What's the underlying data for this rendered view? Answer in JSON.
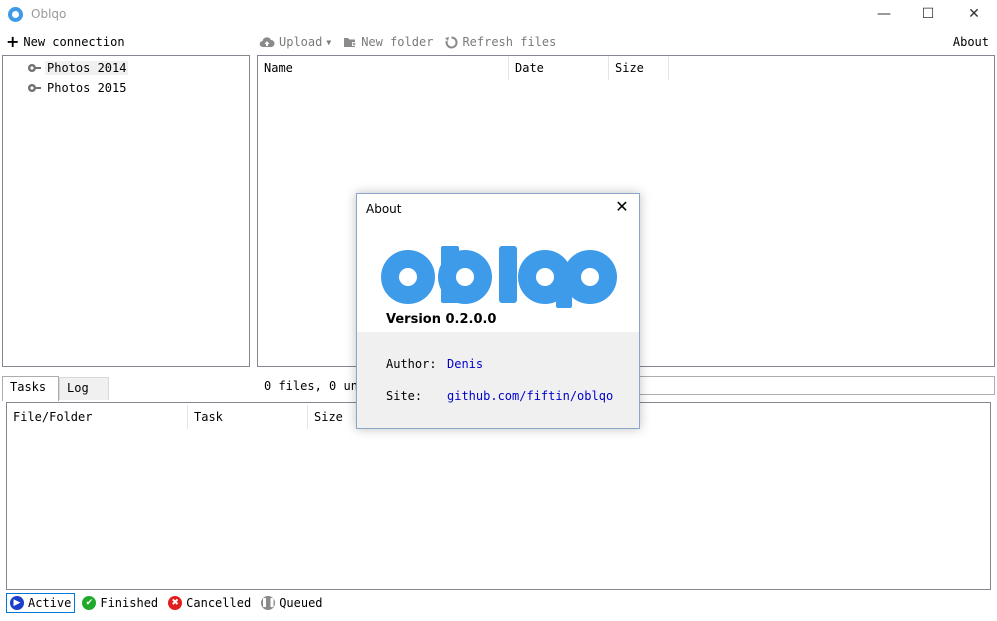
{
  "window": {
    "title": "Oblqo",
    "minimize": "—",
    "maximize": "☐",
    "close": "✕"
  },
  "toolbar": {
    "new_connection": "New connection",
    "upload": "Upload",
    "new_folder": "New folder",
    "refresh": "Refresh files",
    "about": "About"
  },
  "tree": {
    "items": [
      {
        "label": "Photos 2014",
        "selected": true
      },
      {
        "label": "Photos 2015",
        "selected": false
      }
    ]
  },
  "files": {
    "columns": [
      "Name",
      "Date",
      "Size"
    ]
  },
  "bottom": {
    "tabs": [
      "Tasks",
      "Log"
    ],
    "status": "0 files, 0 una",
    "task_columns": [
      "File/Folder",
      "Task",
      "Size"
    ]
  },
  "filters": [
    {
      "label": "Active",
      "icon": "play-icon",
      "color": "#1a3fcc"
    },
    {
      "label": "Finished",
      "icon": "check-icon",
      "color": "#1faa2a"
    },
    {
      "label": "Cancelled",
      "icon": "x-icon",
      "color": "#e11d1d"
    },
    {
      "label": "Queued",
      "icon": "pause-icon",
      "color": "#8a8a8a"
    }
  ],
  "about_dialog": {
    "title": "About",
    "close": "✕",
    "version": "Version 0.2.0.0",
    "author_label": "Author:",
    "author_value": "Denis",
    "site_label": "Site:",
    "site_value": "github.com/fiftin/oblqo"
  },
  "colors": {
    "accent": "#3d9be9",
    "link": "#0000cd"
  }
}
